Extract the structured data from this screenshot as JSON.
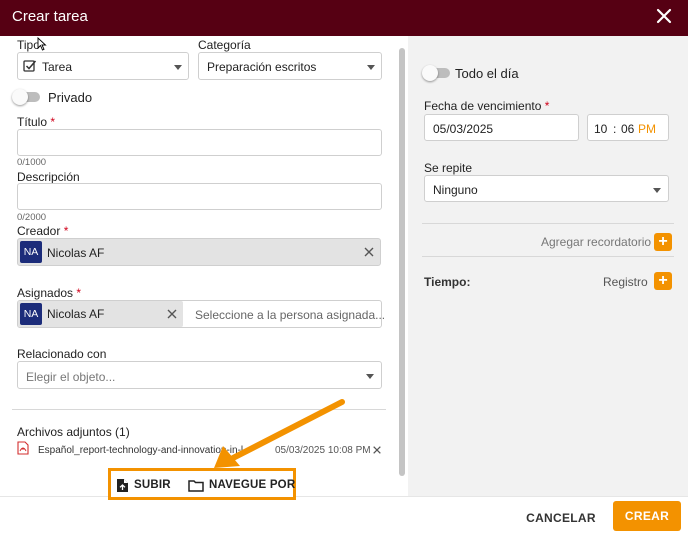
{
  "dialog": {
    "title": "Crear tarea",
    "close_icon": "close-icon"
  },
  "form": {
    "tipo_label": "Tipo",
    "tipo_value": "Tarea",
    "categoria_label": "Categoría",
    "categoria_value": "Preparación escritos",
    "privado_label": "Privado",
    "titulo_label": "Título",
    "titulo_value": "",
    "titulo_counter": "0/1000",
    "descripcion_label": "Descripción",
    "descripcion_value": "",
    "descripcion_counter": "0/2000",
    "creador_label": "Creador",
    "creador_initials": "NA",
    "creador_name": "Nicolas AF",
    "asignados_label": "Asignados",
    "asignados_initials": "NA",
    "asignados_name": "Nicolas AF",
    "asignados_placeholder": "Seleccione a la persona asignada...",
    "relacionado_label": "Relacionado con",
    "relacionado_placeholder": "Elegir el objeto...",
    "required_mark": "*"
  },
  "attachments": {
    "header": "Archivos adjuntos (1)",
    "file_name": "Español_report-technology-and-innovation-in-l",
    "file_date": "05/03/2025 10:08 PM",
    "upload_label": "SUBIR",
    "browse_label": "NAVEGUE POR"
  },
  "right": {
    "todo_el_dia_label": "Todo el día",
    "fecha_label": "Fecha de vencimiento",
    "fecha_value": "05/03/2025",
    "hour": "10",
    "time_sep": ":",
    "minute": "06",
    "ampm": "PM",
    "se_repite_label": "Se repite",
    "se_repite_value": "Ninguno",
    "recordatorio_label": "Agregar recordatorio",
    "tiempo_label": "Tiempo:",
    "registro_label": "Registro",
    "plus_symbol": "+"
  },
  "footer": {
    "cancel_label": "CANCELAR",
    "create_label": "CREAR"
  },
  "colors": {
    "titlebar": "#560013",
    "accent": "#f39200",
    "avatar": "#1c2c7a",
    "required": "#d0021b"
  }
}
